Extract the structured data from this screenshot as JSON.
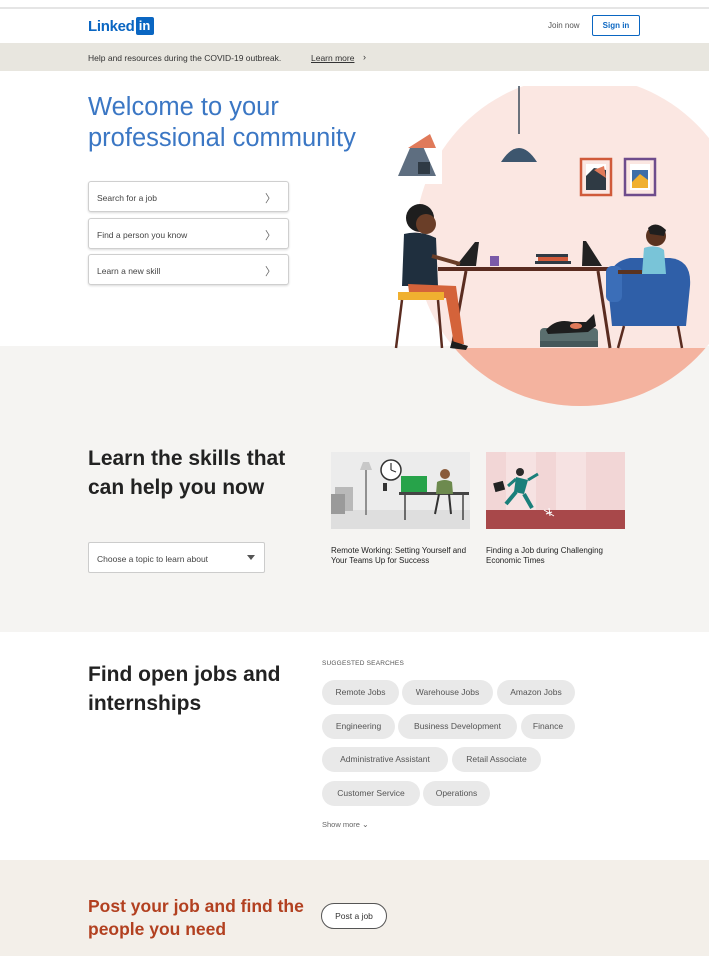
{
  "header": {
    "logo_text": "Linked",
    "logo_in": "in",
    "join_label": "Join now",
    "signin_label": "Sign in"
  },
  "banner": {
    "text": "Help and resources during the COVID-19 outbreak.",
    "link": "Learn more"
  },
  "hero": {
    "title": "Welcome to your professional community",
    "options": [
      {
        "label": "Search for a job"
      },
      {
        "label": "Find a person you know"
      },
      {
        "label": "Learn a new skill"
      }
    ]
  },
  "learn": {
    "title": "Learn the skills that can help you now",
    "select_label": "Choose a topic to learn about",
    "courses": [
      {
        "caption": "Remote Working: Setting Yourself and Your Teams Up for Success"
      },
      {
        "caption": "Finding a Job during Challenging Economic Times"
      }
    ]
  },
  "jobs": {
    "title": "Find open jobs and internships",
    "suggested_label": "SUGGESTED SEARCHES",
    "pills": [
      "Remote Jobs",
      "Warehouse Jobs",
      "Amazon Jobs",
      "Engineering",
      "Business Development",
      "Finance",
      "Administrative Assistant",
      "Retail Associate",
      "Customer Service",
      "Operations"
    ],
    "show_more": "Show more"
  },
  "post": {
    "title": "Post your job and find the people you need",
    "button": "Post a job"
  },
  "colors": {
    "brand": "#0a66c2",
    "hero_title": "#3b77c4",
    "post_title": "#b24020",
    "banner_bg": "#e8e6df",
    "learn_bg": "#f5f4f2",
    "post_bg": "#f3efe9"
  }
}
